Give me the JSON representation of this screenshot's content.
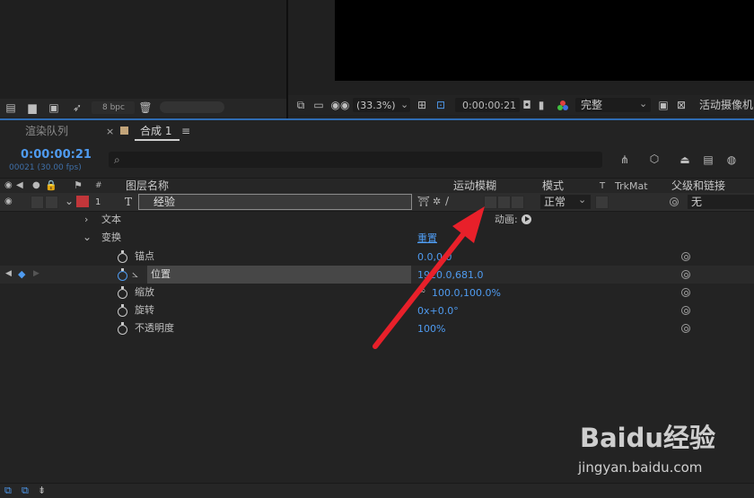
{
  "project_panel": {
    "bpc_label": "8 bpc"
  },
  "viewer_bar": {
    "zoom": "(33.3%)",
    "timecode": "0:00:00:21",
    "resolution": "完整",
    "camera": "活动摄像机"
  },
  "tabs": {
    "render_queue": "渲染队列",
    "composition": "合成 1",
    "close_glyph": "×",
    "menu_glyph": "≡"
  },
  "timeline": {
    "current_time": "0:00:00:21",
    "frame_info": "00021 (30.00 fps)",
    "search_icon_glyph": "⌕",
    "columns": {
      "number": "#",
      "layer_name": "图层名称",
      "motion_blur": "运动模糊",
      "mode": "模式",
      "t": "T",
      "trkmat": "TrkMat",
      "parent": "父级和链接"
    },
    "layer": {
      "number": "1",
      "type_glyph": "T",
      "name": "经验",
      "mode": "正常",
      "parent": "无",
      "color": "#c1363a"
    },
    "text_group": {
      "label": "文本",
      "animate_label": "动画:"
    },
    "transform_group": {
      "label": "变换",
      "reset": "重置"
    },
    "properties": [
      {
        "name": "锚点",
        "value": "0.0,0.0"
      },
      {
        "name": "位置",
        "value": "1920.0,681.0"
      },
      {
        "name": "缩放",
        "value": "100.0,100.0%"
      },
      {
        "name": "旋转",
        "value": "0x+0.0°"
      },
      {
        "name": "不透明度",
        "value": "100%"
      }
    ]
  },
  "watermark": {
    "logo": "Baidu经验",
    "url": "jingyan.baidu.com"
  },
  "colors": {
    "accent": "#4f9bf0",
    "arrow": "#e8202a",
    "label_red": "#c1363a"
  }
}
